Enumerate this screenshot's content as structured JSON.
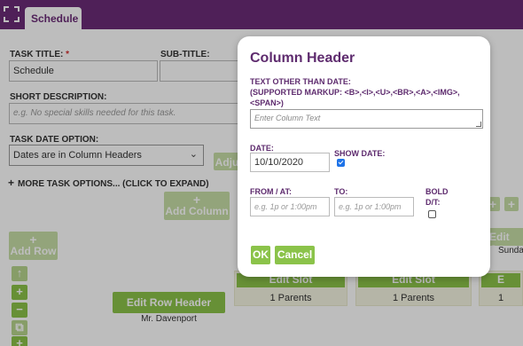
{
  "header": {
    "tab_label": "Schedule"
  },
  "form": {
    "task_title_label": "TASK TITLE:",
    "task_title_required": "*",
    "task_title_value": "Schedule",
    "subtitle_label": "SUB-TITLE:",
    "short_desc_label": "SHORT DESCRIPTION:",
    "short_desc_placeholder": "e.g. No special skills needed for this task.",
    "date_option_label": "TASK DATE OPTION:",
    "date_option_value": "Dates are in Column Headers",
    "adjust_label": "Adju",
    "more_options": "MORE TASK OPTIONS... (CLICK TO EXPAND)"
  },
  "grid": {
    "add_column_label": "Add Column",
    "add_row_label": "Add Row",
    "edit_col_label": "Edit Co",
    "edit_col_sub": "Sunda",
    "edit_row_header_label": "Edit Row Header",
    "row_name": "Mr. Davenport",
    "slots": [
      {
        "label": "Edit Slot",
        "count": "1 Parents"
      },
      {
        "label": "Edit Slot",
        "count": "1 Parents"
      },
      {
        "label": "E",
        "count": "1"
      }
    ]
  },
  "modal": {
    "title": "Column Header",
    "text_label_line1": "TEXT OTHER THAN DATE:",
    "text_label_line2": "(SUPPORTED MARKUP: <B>,<I>,<U>,<BR>,<A>,<IMG>,",
    "text_label_line3": "<SPAN>)",
    "text_placeholder": "Enter Column Text",
    "date_label": "DATE:",
    "date_value": "10/10/2020",
    "show_date_label": "SHOW DATE:",
    "show_date_checked": true,
    "from_label": "FROM / AT:",
    "from_placeholder": "e.g. 1p or 1:00pm",
    "to_label": "TO:",
    "to_placeholder": "e.g. 1p or 1:00pm",
    "bold_label_line1": "BOLD",
    "bold_label_line2": "D/T:",
    "bold_checked": false,
    "ok_label": "OK",
    "cancel_label": "Cancel"
  },
  "colors": {
    "brand_purple": "#6b2c77",
    "modal_title": "#5e2b6e",
    "button_green": "#8bc34a",
    "checkbox_blue": "#1e73e8"
  }
}
